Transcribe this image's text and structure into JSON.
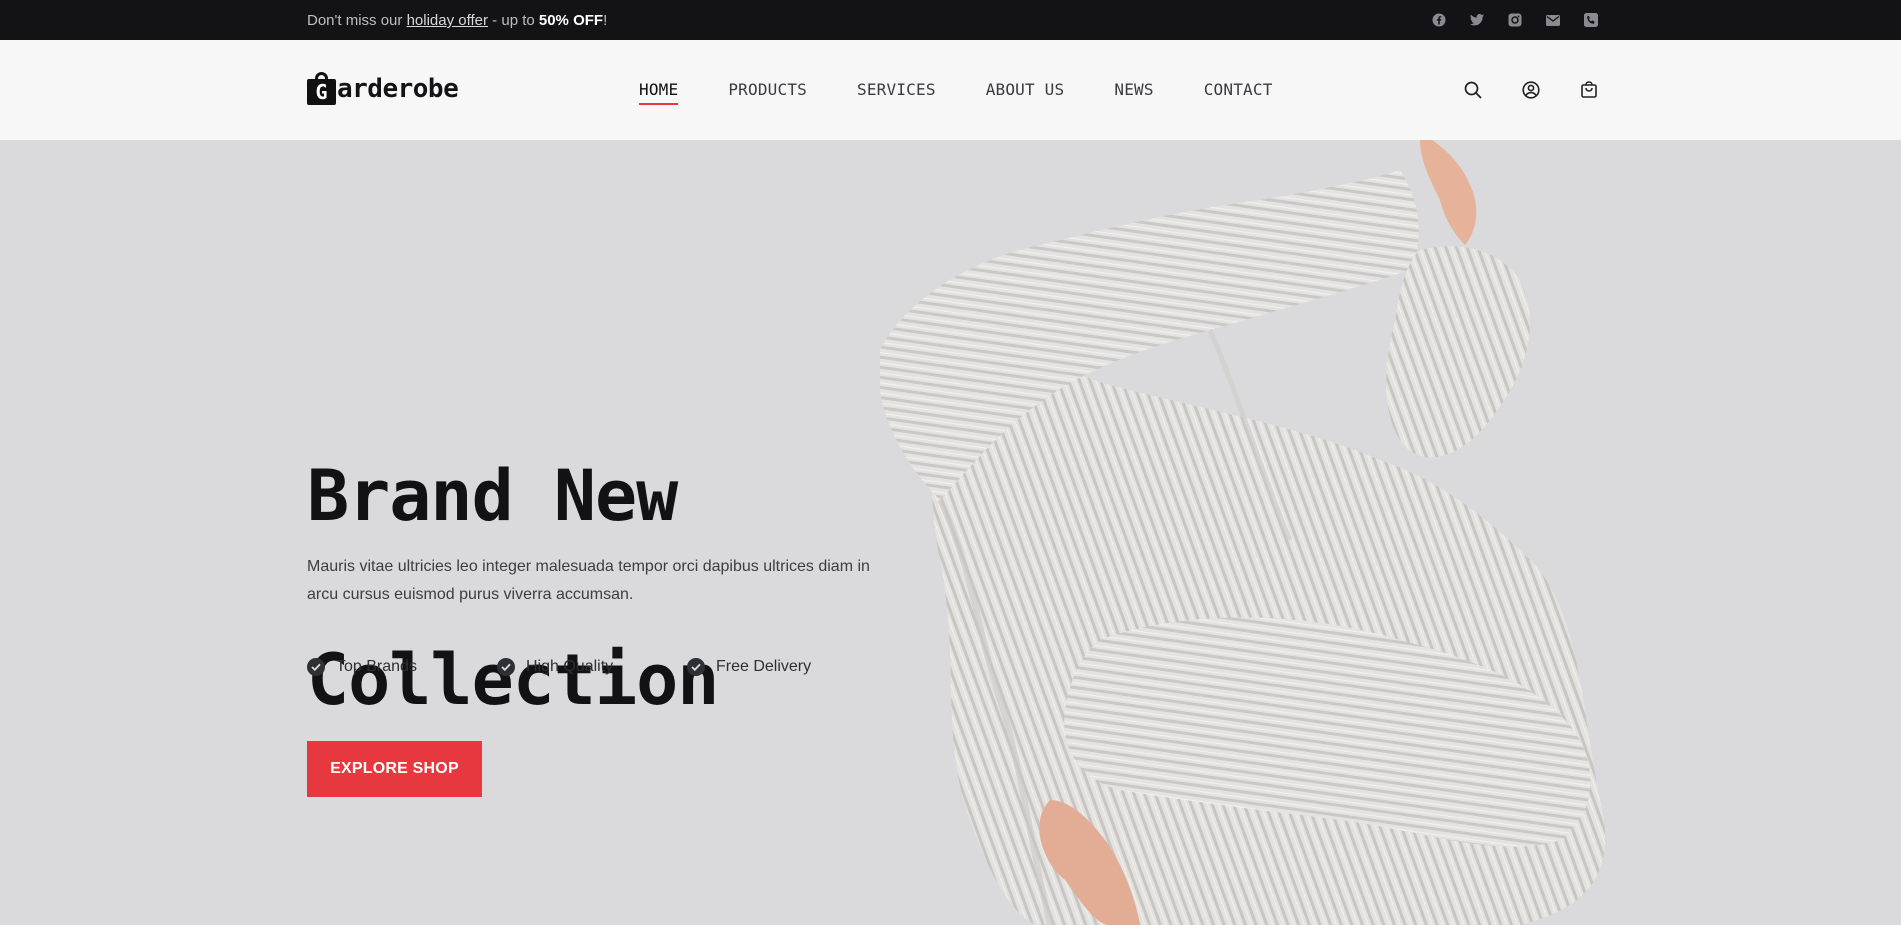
{
  "topbar": {
    "promo_prefix": "Don't miss our ",
    "promo_link": "holiday offer",
    "promo_middle": " - up to ",
    "promo_bold": "50% OFF",
    "promo_suffix": "!",
    "socials": [
      "facebook-icon",
      "twitter-icon",
      "instagram-icon",
      "mail-icon",
      "phone-icon"
    ]
  },
  "header": {
    "logo_letter": "G",
    "logo_word": "arderobe",
    "nav": [
      {
        "label": "HOME",
        "active": true
      },
      {
        "label": "PRODUCTS"
      },
      {
        "label": "SERVICES"
      },
      {
        "label": "ABOUT US"
      },
      {
        "label": "NEWS"
      },
      {
        "label": "CONTACT"
      }
    ],
    "icons": [
      "search-icon",
      "user-icon",
      "cart-icon"
    ]
  },
  "hero": {
    "title_line1": "Brand New",
    "title_line2": "Collection",
    "description": "Mauris vitae ultricies leo integer malesuada tempor orci dapibus ultrices diam in arcu cursus euismod purus viverra accumsan.",
    "features": [
      "Top Brands",
      "High Quality",
      "Free Delivery"
    ],
    "cta_label": "EXPLORE SHOP"
  },
  "colors": {
    "accent": "#e8383f",
    "topbar_bg": "#131316",
    "header_bg": "#f7f7f8",
    "hero_bg": "#dadadc"
  }
}
